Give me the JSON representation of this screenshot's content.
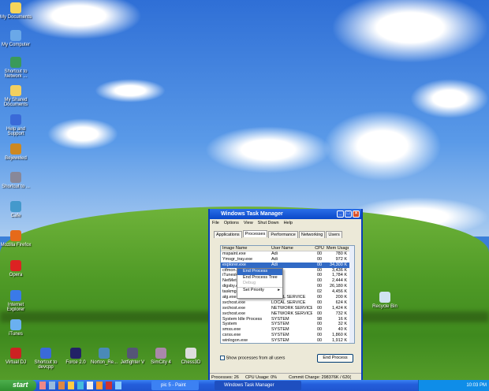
{
  "desktop": {
    "icons_left": [
      "My Documents",
      "My Computer",
      "Shortcut to Network ...",
      "My Shared Documents",
      "Help and Support",
      "Bejeweled",
      "Shortcut to ...",
      "Cafe",
      "Mozilla Firefox",
      "Opera",
      "Internet Explorer",
      "iTunes"
    ],
    "icons_bottom": [
      "Virtual DJ",
      "Shortcut to devcpp",
      "Force 2.0",
      "Norton_Re...",
      "Jetfighter V",
      "SimCity 4",
      "Chess3D"
    ],
    "recycle_bin": "Recycle Bin"
  },
  "task_manager": {
    "title": "Windows Task Manager",
    "menu": [
      "File",
      "Options",
      "View",
      "Shut Down",
      "Help"
    ],
    "tabs": [
      "Applications",
      "Processes",
      "Performance",
      "Networking",
      "Users"
    ],
    "active_tab": "Processes",
    "columns": [
      "Image Name",
      "User Name",
      "CPU",
      "Mem Usage"
    ],
    "rows": [
      [
        "mspaint.exe",
        "Adi",
        "00",
        "780 K"
      ],
      [
        "Ymsgr_tray.exe",
        "Adi",
        "00",
        "972 K"
      ],
      [
        "explorer.exe",
        "Adi",
        "00",
        "34,300 K"
      ],
      [
        "ctfmon.exe",
        "",
        "00",
        "3,436 K"
      ],
      [
        "iTunesHelper.exe",
        "",
        "00",
        "1,784 K"
      ],
      [
        "NetMeter.exe",
        "",
        "00",
        "2,444 K"
      ],
      [
        "digsby.exe",
        "",
        "00",
        "26,180 K"
      ],
      [
        "taskmgr.exe",
        "",
        "02",
        "4,456 K"
      ],
      [
        "alg.exe",
        "LOCAL SERVICE",
        "00",
        "200 K"
      ],
      [
        "svchost.exe",
        "LOCAL SERVICE",
        "00",
        "624 K"
      ],
      [
        "svchost.exe",
        "NETWORK SERVICE",
        "00",
        "1,424 K"
      ],
      [
        "svchost.exe",
        "NETWORK SERVICE",
        "00",
        "732 K"
      ],
      [
        "System Idle Process",
        "SYSTEM",
        "98",
        "16 K"
      ],
      [
        "System",
        "SYSTEM",
        "00",
        "32 K"
      ],
      [
        "smss.exe",
        "SYSTEM",
        "00",
        "40 K"
      ],
      [
        "csrss.exe",
        "SYSTEM",
        "00",
        "1,860 K"
      ],
      [
        "winlogon.exe",
        "SYSTEM",
        "00",
        "1,912 K"
      ],
      [
        "services.exe",
        "SYSTEM",
        "00",
        "1,716 K"
      ]
    ],
    "selected_row": 2,
    "context_menu": [
      "End Process",
      "End Process Tree",
      "Debug",
      "Set Priority"
    ],
    "show_all_label": "Show processes from all users",
    "end_process_label": "End Process",
    "status": {
      "processes": "Processes: 26",
      "cpu": "CPU Usage: 0%",
      "commit": "Commit Charge: 298376K / 620("
    }
  },
  "taskbar": {
    "start": "start",
    "buttons": [
      "pic 5 - Paint",
      "Windows Task Manager"
    ],
    "clock": "10:03 PM"
  }
}
